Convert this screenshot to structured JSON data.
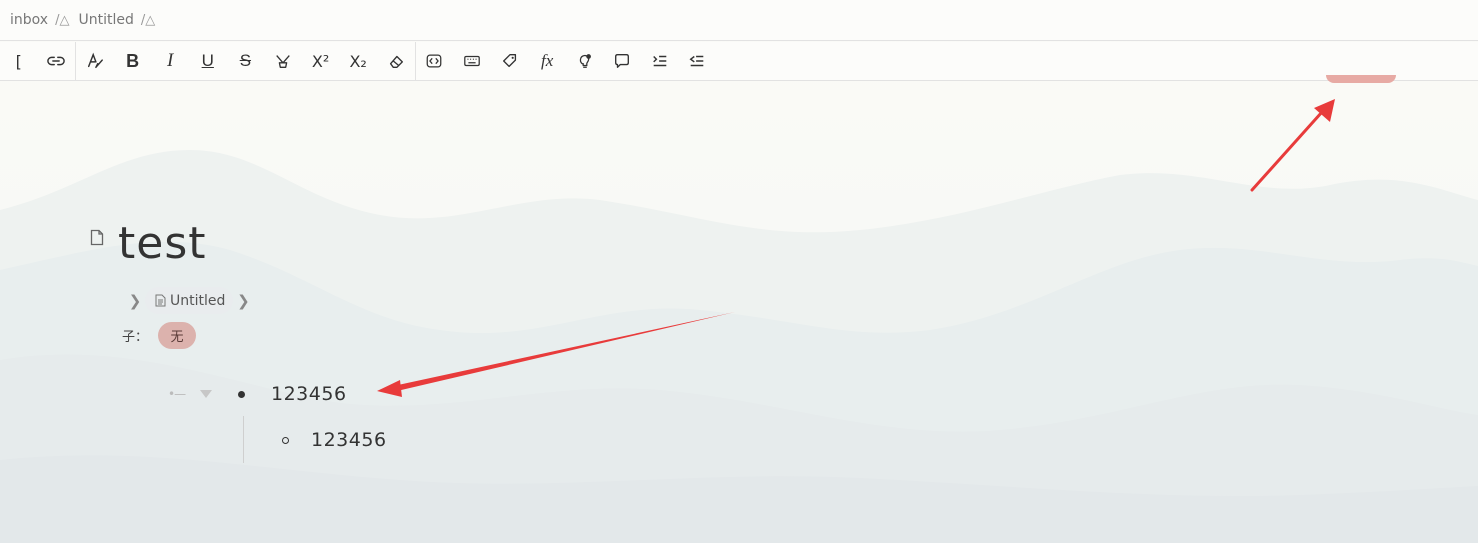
{
  "breadcrumb": [
    {
      "label": "inbox",
      "sep": "/△"
    },
    {
      "label": "Untitled",
      "sep": "/△"
    }
  ],
  "toolbar": {
    "items": [
      {
        "name": "bracket-button",
        "glyph": "["
      },
      {
        "name": "link-icon",
        "glyph": "link"
      },
      {
        "name": "font-color-icon",
        "glyph": "A"
      },
      {
        "name": "bold-button",
        "glyph": "B"
      },
      {
        "name": "italic-button",
        "glyph": "I"
      },
      {
        "name": "underline-button",
        "glyph": "U"
      },
      {
        "name": "strikethrough-button",
        "glyph": "S"
      },
      {
        "name": "highlight-icon",
        "glyph": "highlight"
      },
      {
        "name": "superscript-button",
        "glyph": "X²"
      },
      {
        "name": "subscript-button",
        "glyph": "X₂"
      },
      {
        "name": "eraser-icon",
        "glyph": "eraser"
      },
      {
        "name": "inline-code-icon",
        "glyph": "code"
      },
      {
        "name": "keyboard-icon",
        "glyph": "keyboard"
      },
      {
        "name": "tag-icon",
        "glyph": "tag"
      },
      {
        "name": "formula-icon",
        "glyph": "fx"
      },
      {
        "name": "idea-icon",
        "glyph": "bulb"
      },
      {
        "name": "comment-icon",
        "glyph": "comment"
      },
      {
        "name": "indent-icon",
        "glyph": "indent"
      },
      {
        "name": "outdent-icon",
        "glyph": "outdent"
      }
    ]
  },
  "doc": {
    "title": "test",
    "path_chip": "Untitled",
    "child_label": "子：",
    "child_tag": "无"
  },
  "list": {
    "item1": "123456",
    "item2": "123456"
  },
  "colors": {
    "accent_red": "#e94040",
    "tag_bg": "#dcb2ad"
  }
}
